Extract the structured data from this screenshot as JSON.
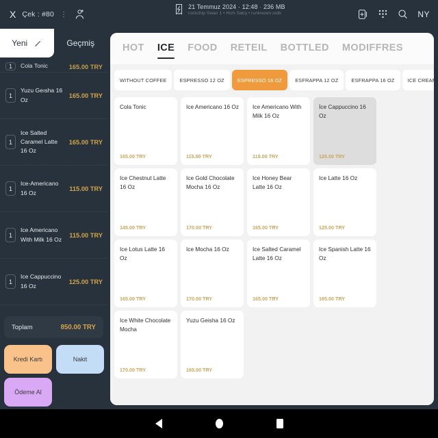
{
  "topbar": {
    "close_label": "X",
    "check_label": "Çek : #80",
    "kebab": "⋮",
    "add_user_icon": "add-user-icon",
    "receipt_icon": "receipt-icon",
    "datetime": "21 Temmuz 2024 · 12:48",
    "memory_separator": "·",
    "memory": "236 MB",
    "subtitle": "rockchip Swan 1 • Hızlı Satış • runknown ostb",
    "add_note_icon": "add-note-icon",
    "keypad_icon": "keypad-icon",
    "search_icon": "search-icon",
    "user_initials": "NY"
  },
  "sidebar": {
    "tabs": [
      {
        "label": "Yeni",
        "active": true,
        "icon": "pencil-icon"
      },
      {
        "label": "Geçmiş",
        "active": false
      }
    ],
    "cart_items": [
      {
        "qty": "1",
        "name": "Cola Tonic",
        "price": "165.00 TRY",
        "clipped": true
      },
      {
        "qty": "1",
        "name": "Yuzu Geısha 16 Oz",
        "price": "165.00 TRY",
        "clipped": false
      },
      {
        "qty": "1",
        "name": "Ice Salted Caramel Latte 16 Oz",
        "price": "165.00 TRY",
        "clipped": false
      },
      {
        "qty": "1",
        "name": "Ice-Americano 16 Oz",
        "price": "115.00 TRY",
        "clipped": false
      },
      {
        "qty": "1",
        "name": "Ice Americano With Milk 16 Oz",
        "price": "115.00 TRY",
        "clipped": false
      },
      {
        "qty": "1",
        "name": "Ice Cappuccino 16 Oz",
        "price": "125.00 TRY",
        "clipped": false
      }
    ],
    "total_label": "Toplam",
    "total_value": "850.00 TRY",
    "payment_buttons": [
      {
        "label": "Kredi Kartı",
        "color": "#f8c28a"
      },
      {
        "label": "Nakit",
        "color": "#c4ddf7"
      },
      {
        "label": "Ödeme Al",
        "color": "#d9a9f5"
      }
    ]
  },
  "main": {
    "category_tabs": [
      {
        "label": "HOT",
        "active": false
      },
      {
        "label": "ICE",
        "active": true
      },
      {
        "label": "FOOD",
        "active": false
      },
      {
        "label": "RETEIL",
        "active": false
      },
      {
        "label": "BOTTLED",
        "active": false
      },
      {
        "label": "MODIFFRES",
        "active": false
      }
    ],
    "chips": [
      {
        "label": "WITHOUT COFFEE",
        "active": false
      },
      {
        "label": "ESPRESSO 12 OZ",
        "active": false
      },
      {
        "label": "ESPRESSO 16 OZ",
        "active": true
      },
      {
        "label": "ESFRAPPA 12 OZ",
        "active": false
      },
      {
        "label": "ESFRAPPA 16 OZ",
        "active": false
      },
      {
        "label": "ICE CREAM&MILKSHAKE",
        "active": false
      }
    ],
    "products": [
      {
        "name": "Cola Tonic",
        "price": "165.00 TRY",
        "selected": false
      },
      {
        "name": "Ice Americano 16 Oz",
        "price": "115.00 TRY",
        "selected": false
      },
      {
        "name": "Ice Americano With Milk 16 Oz",
        "price": "115.00 TRY",
        "selected": false
      },
      {
        "name": "İce Cappuccino 16 Oz",
        "price": "125.00 TRY",
        "selected": true
      },
      {
        "name": "Ice Chestnut Latte 16 Oz",
        "price": "145.00 TRY",
        "selected": false
      },
      {
        "name": "Ice Gold Chocolate Mocha 16 Oz",
        "price": "170.00 TRY",
        "selected": false
      },
      {
        "name": "Ice Honey Bear Latte 16 Oz",
        "price": "165.00 TRY",
        "selected": false
      },
      {
        "name": "Ice Latte 16 Oz",
        "price": "125.00 TRY",
        "selected": false
      },
      {
        "name": "Ice Lotus Latte 16 Oz",
        "price": "165.00 TRY",
        "selected": false
      },
      {
        "name": "Ice Mocha 16 Oz",
        "price": "170.00 TRY",
        "selected": false
      },
      {
        "name": "Ice Salted Caramel Latte 16 Oz",
        "price": "165.00 TRY",
        "selected": false
      },
      {
        "name": "Ice Spanish Latte 16 Oz",
        "price": "165.00 TRY",
        "selected": false
      },
      {
        "name": "Ice White Chocolate Mocha",
        "price": "170.00 TRY",
        "selected": false
      },
      {
        "name": "Yuzu Geisha 16 Oz",
        "price": "165.00 TRY",
        "selected": false
      }
    ]
  },
  "navbar": {
    "back_icon": "back-triangle-icon",
    "home_icon": "home-circle-icon",
    "recents_icon": "recents-square-icon"
  },
  "colors": {
    "dark_bg": "#28323c",
    "accent_orange": "#ef9b3d",
    "price_gold": "#c9a65c",
    "panel_bg": "#f2f2f2"
  }
}
